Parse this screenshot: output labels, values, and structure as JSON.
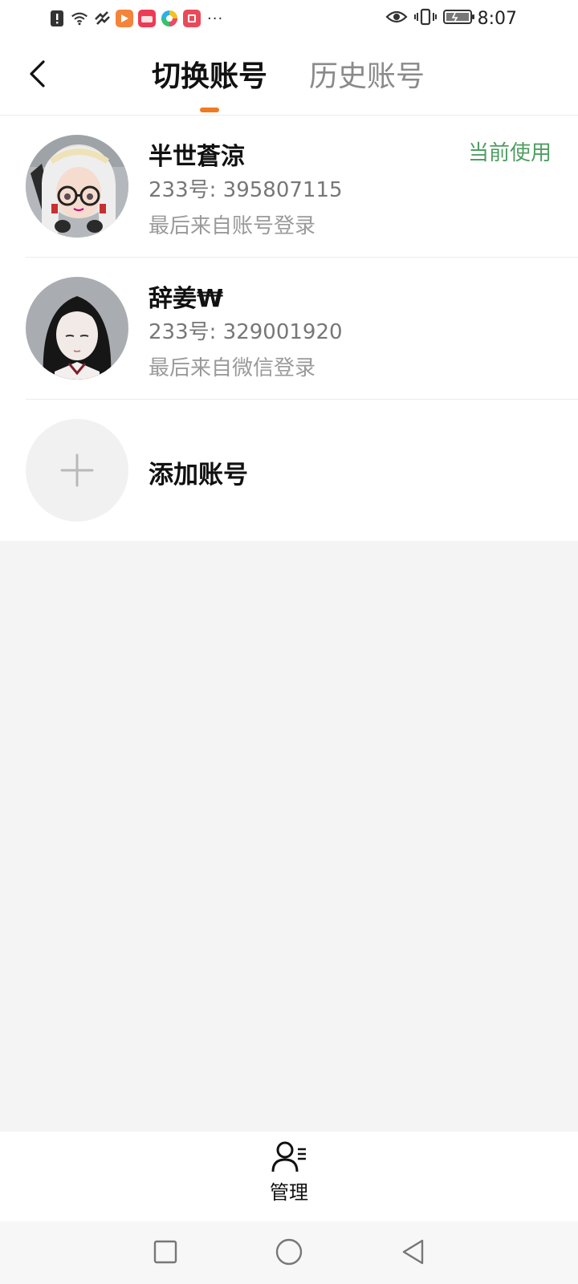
{
  "status_bar": {
    "time": "8:07",
    "left_icons": [
      "notification-alert-icon",
      "wifi-icon",
      "link-icon",
      "app-video-icon",
      "app-shop-icon",
      "app-colorful-icon",
      "app-book-icon"
    ],
    "more": "···",
    "right_icons": [
      "eye-icon",
      "vibrate-icon",
      "battery-icon"
    ],
    "colors": {
      "app_video": "#f5833a",
      "app_shop": "#ee3b55",
      "app_book": "#e94a5a"
    }
  },
  "header": {
    "tabs": [
      {
        "label": "切换账号",
        "active": true
      },
      {
        "label": "历史账号",
        "active": false
      }
    ],
    "indicator_color": "#f07a22"
  },
  "accounts": [
    {
      "name": "半世蒼涼",
      "id_line": "233号: 395807115",
      "login_line": "最后来自账号登录",
      "current_label": "当前使用"
    },
    {
      "name": "辞姜₩",
      "id_line": "233号: 329001920",
      "login_line": "最后来自微信登录"
    }
  ],
  "add_account": {
    "label": "添加账号"
  },
  "bottom_bar": {
    "manage_label": "管理"
  },
  "nav_bar": {
    "buttons": [
      "recent-apps",
      "home",
      "back"
    ]
  },
  "colors": {
    "current_badge": "#4f9e62",
    "background_gray": "#f4f4f4"
  }
}
